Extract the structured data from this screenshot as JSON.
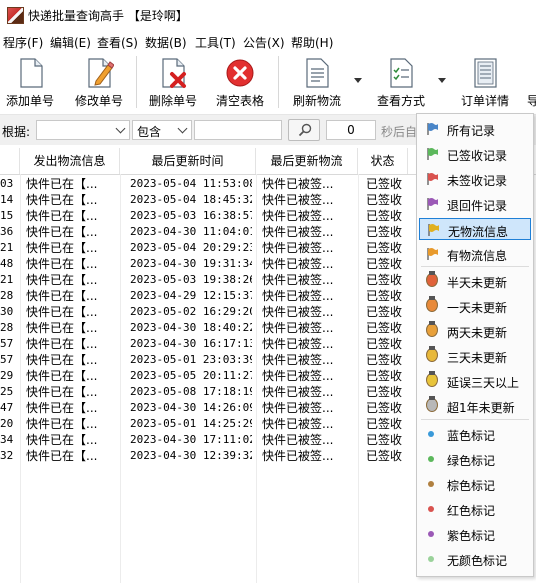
{
  "window": {
    "title": "快递批量查询高手 【是玲啊】"
  },
  "menu": [
    "程序(F)",
    "编辑(E)",
    "查看(S)",
    "数据(B)",
    "工具(T)",
    "公告(X)",
    "帮助(H)"
  ],
  "toolbar": {
    "add": "添加单号",
    "edit": "修改单号",
    "delete": "删除单号",
    "clear": "清空表格",
    "refresh": "刷新物流",
    "view": "查看方式",
    "details": "订单详情",
    "export_partial": "导"
  },
  "filter": {
    "label": "根据:",
    "field_value": "",
    "operator": "包含",
    "search_value": "",
    "interval": "0",
    "interval_suffix": "秒后自"
  },
  "grid": {
    "columns": [
      "发出物流信息",
      "最后更新时间",
      "最后更新物流",
      "状态"
    ],
    "rows": [
      {
        "id": "03",
        "sent": "快件已在【...",
        "time": "2023-05-04 11:53:08",
        "last": "快件已被签...",
        "status": "已签收"
      },
      {
        "id": "14",
        "sent": "快件已在【...",
        "time": "2023-05-04 18:45:32",
        "last": "快件已被签...",
        "status": "已签收"
      },
      {
        "id": "15",
        "sent": "快件已在【...",
        "time": "2023-05-03 16:38:57",
        "last": "快件已被签...",
        "status": "已签收"
      },
      {
        "id": "36",
        "sent": "快件已在【...",
        "time": "2023-04-30 11:04:01",
        "last": "快件已被签...",
        "status": "已签收"
      },
      {
        "id": "21",
        "sent": "快件已在【...",
        "time": "2023-05-04 20:29:23",
        "last": "快件已被签...",
        "status": "已签收"
      },
      {
        "id": "48",
        "sent": "快件已在【...",
        "time": "2023-04-30 19:31:34",
        "last": "快件已被签...",
        "status": "已签收"
      },
      {
        "id": "21",
        "sent": "快件已在【...",
        "time": "2023-05-03 19:38:26",
        "last": "快件已被签...",
        "status": "已签收"
      },
      {
        "id": "28",
        "sent": "快件已在【...",
        "time": "2023-04-29 12:15:37",
        "last": "快件已被签...",
        "status": "已签收"
      },
      {
        "id": "30",
        "sent": "快件已在【...",
        "time": "2023-05-02 16:29:20",
        "last": "快件已被签...",
        "status": "已签收"
      },
      {
        "id": "28",
        "sent": "快件已在【...",
        "time": "2023-04-30 18:40:22",
        "last": "快件已被签...",
        "status": "已签收"
      },
      {
        "id": "57",
        "sent": "快件已在【...",
        "time": "2023-04-30 16:17:13",
        "last": "快件已被签...",
        "status": "已签收"
      },
      {
        "id": "57",
        "sent": "快件已在【...",
        "time": "2023-05-01 23:03:39",
        "last": "快件已被签...",
        "status": "已签收"
      },
      {
        "id": "29",
        "sent": "快件已在【...",
        "time": "2023-05-05 20:11:27",
        "last": "快件已被签...",
        "status": "已签收"
      },
      {
        "id": "25",
        "sent": "快件已在【...",
        "time": "2023-05-08 17:18:19",
        "last": "快件已被签...",
        "status": "已签收"
      },
      {
        "id": "47",
        "sent": "快件已在【...",
        "time": "2023-04-30 14:26:09",
        "last": "快件已被签...",
        "status": "已签收"
      },
      {
        "id": "20",
        "sent": "快件已在【...",
        "time": "2023-05-01 14:25:29",
        "last": "快件已被签...",
        "status": "已签收"
      },
      {
        "id": "34",
        "sent": "快件已在【...",
        "time": "2023-04-30 17:11:02",
        "last": "快件已被签...",
        "status": "已签收"
      },
      {
        "id": "32",
        "sent": "快件已在【...",
        "time": "2023-04-30 12:39:32",
        "last": "快件已被签...",
        "status": "已签收"
      }
    ]
  },
  "view_menu": {
    "groups": [
      [
        {
          "label": "所有记录",
          "icon": "flag-blue-icon",
          "color": "#4a86c8"
        },
        {
          "label": "已签收记录",
          "icon": "flag-green-icon",
          "color": "#5cb85c"
        },
        {
          "label": "未签收记录",
          "icon": "flag-red-icon",
          "color": "#d9534f"
        },
        {
          "label": "退回件记录",
          "icon": "flag-purple-icon",
          "color": "#9b59b6"
        },
        {
          "label": "无物流信息",
          "icon": "flag-yellow-icon",
          "color": "#e0b020",
          "selected": true
        },
        {
          "label": "有物流信息",
          "icon": "flag-orange-icon",
          "color": "#e89a2c"
        }
      ],
      [
        {
          "label": "半天未更新",
          "icon": "medal-red-icon",
          "color": "#e0623a"
        },
        {
          "label": "一天未更新",
          "icon": "medal-orange-icon",
          "color": "#e88a3a"
        },
        {
          "label": "两天未更新",
          "icon": "medal-orange-icon",
          "color": "#e8a03a"
        },
        {
          "label": "三天未更新",
          "icon": "medal-gold-icon",
          "color": "#e8b83a"
        },
        {
          "label": "延误三天以上",
          "icon": "medal-gold-icon",
          "color": "#e8c43a"
        },
        {
          "label": "超1年未更新",
          "icon": "medal-silver-icon",
          "color": "#b8b8b8"
        }
      ],
      [
        {
          "label": "蓝色标记",
          "icon": "dot-blue-icon",
          "color": "#3a9ad9"
        },
        {
          "label": "绿色标记",
          "icon": "dot-green-icon",
          "color": "#5cb85c"
        },
        {
          "label": "棕色标记",
          "icon": "dot-brown-icon",
          "color": "#b08040"
        },
        {
          "label": "红色标记",
          "icon": "dot-red-icon",
          "color": "#d9534f"
        },
        {
          "label": "紫色标记",
          "icon": "dot-purple-icon",
          "color": "#9b59b6"
        },
        {
          "label": "无颜色标记",
          "icon": "dot-none-icon",
          "color": "#9ad29a"
        }
      ]
    ]
  }
}
